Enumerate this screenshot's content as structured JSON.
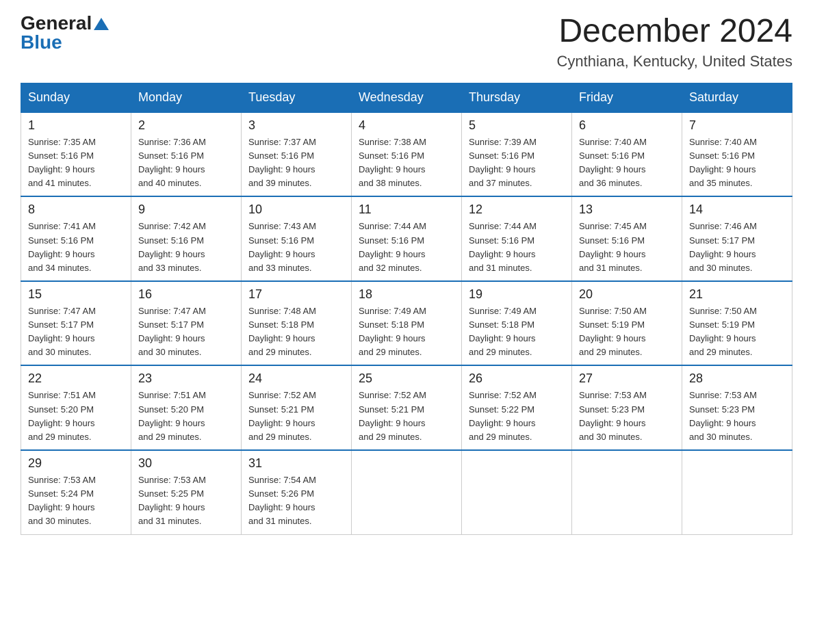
{
  "logo": {
    "general": "General",
    "blue": "Blue",
    "arrow": "▲"
  },
  "title": "December 2024",
  "location": "Cynthiana, Kentucky, United States",
  "days_of_week": [
    "Sunday",
    "Monday",
    "Tuesday",
    "Wednesday",
    "Thursday",
    "Friday",
    "Saturday"
  ],
  "weeks": [
    [
      {
        "day": "1",
        "sunrise": "7:35 AM",
        "sunset": "5:16 PM",
        "daylight": "9 hours and 41 minutes."
      },
      {
        "day": "2",
        "sunrise": "7:36 AM",
        "sunset": "5:16 PM",
        "daylight": "9 hours and 40 minutes."
      },
      {
        "day": "3",
        "sunrise": "7:37 AM",
        "sunset": "5:16 PM",
        "daylight": "9 hours and 39 minutes."
      },
      {
        "day": "4",
        "sunrise": "7:38 AM",
        "sunset": "5:16 PM",
        "daylight": "9 hours and 38 minutes."
      },
      {
        "day": "5",
        "sunrise": "7:39 AM",
        "sunset": "5:16 PM",
        "daylight": "9 hours and 37 minutes."
      },
      {
        "day": "6",
        "sunrise": "7:40 AM",
        "sunset": "5:16 PM",
        "daylight": "9 hours and 36 minutes."
      },
      {
        "day": "7",
        "sunrise": "7:40 AM",
        "sunset": "5:16 PM",
        "daylight": "9 hours and 35 minutes."
      }
    ],
    [
      {
        "day": "8",
        "sunrise": "7:41 AM",
        "sunset": "5:16 PM",
        "daylight": "9 hours and 34 minutes."
      },
      {
        "day": "9",
        "sunrise": "7:42 AM",
        "sunset": "5:16 PM",
        "daylight": "9 hours and 33 minutes."
      },
      {
        "day": "10",
        "sunrise": "7:43 AM",
        "sunset": "5:16 PM",
        "daylight": "9 hours and 33 minutes."
      },
      {
        "day": "11",
        "sunrise": "7:44 AM",
        "sunset": "5:16 PM",
        "daylight": "9 hours and 32 minutes."
      },
      {
        "day": "12",
        "sunrise": "7:44 AM",
        "sunset": "5:16 PM",
        "daylight": "9 hours and 31 minutes."
      },
      {
        "day": "13",
        "sunrise": "7:45 AM",
        "sunset": "5:16 PM",
        "daylight": "9 hours and 31 minutes."
      },
      {
        "day": "14",
        "sunrise": "7:46 AM",
        "sunset": "5:17 PM",
        "daylight": "9 hours and 30 minutes."
      }
    ],
    [
      {
        "day": "15",
        "sunrise": "7:47 AM",
        "sunset": "5:17 PM",
        "daylight": "9 hours and 30 minutes."
      },
      {
        "day": "16",
        "sunrise": "7:47 AM",
        "sunset": "5:17 PM",
        "daylight": "9 hours and 30 minutes."
      },
      {
        "day": "17",
        "sunrise": "7:48 AM",
        "sunset": "5:18 PM",
        "daylight": "9 hours and 29 minutes."
      },
      {
        "day": "18",
        "sunrise": "7:49 AM",
        "sunset": "5:18 PM",
        "daylight": "9 hours and 29 minutes."
      },
      {
        "day": "19",
        "sunrise": "7:49 AM",
        "sunset": "5:18 PM",
        "daylight": "9 hours and 29 minutes."
      },
      {
        "day": "20",
        "sunrise": "7:50 AM",
        "sunset": "5:19 PM",
        "daylight": "9 hours and 29 minutes."
      },
      {
        "day": "21",
        "sunrise": "7:50 AM",
        "sunset": "5:19 PM",
        "daylight": "9 hours and 29 minutes."
      }
    ],
    [
      {
        "day": "22",
        "sunrise": "7:51 AM",
        "sunset": "5:20 PM",
        "daylight": "9 hours and 29 minutes."
      },
      {
        "day": "23",
        "sunrise": "7:51 AM",
        "sunset": "5:20 PM",
        "daylight": "9 hours and 29 minutes."
      },
      {
        "day": "24",
        "sunrise": "7:52 AM",
        "sunset": "5:21 PM",
        "daylight": "9 hours and 29 minutes."
      },
      {
        "day": "25",
        "sunrise": "7:52 AM",
        "sunset": "5:21 PM",
        "daylight": "9 hours and 29 minutes."
      },
      {
        "day": "26",
        "sunrise": "7:52 AM",
        "sunset": "5:22 PM",
        "daylight": "9 hours and 29 minutes."
      },
      {
        "day": "27",
        "sunrise": "7:53 AM",
        "sunset": "5:23 PM",
        "daylight": "9 hours and 30 minutes."
      },
      {
        "day": "28",
        "sunrise": "7:53 AM",
        "sunset": "5:23 PM",
        "daylight": "9 hours and 30 minutes."
      }
    ],
    [
      {
        "day": "29",
        "sunrise": "7:53 AM",
        "sunset": "5:24 PM",
        "daylight": "9 hours and 30 minutes."
      },
      {
        "day": "30",
        "sunrise": "7:53 AM",
        "sunset": "5:25 PM",
        "daylight": "9 hours and 31 minutes."
      },
      {
        "day": "31",
        "sunrise": "7:54 AM",
        "sunset": "5:26 PM",
        "daylight": "9 hours and 31 minutes."
      },
      null,
      null,
      null,
      null
    ]
  ]
}
